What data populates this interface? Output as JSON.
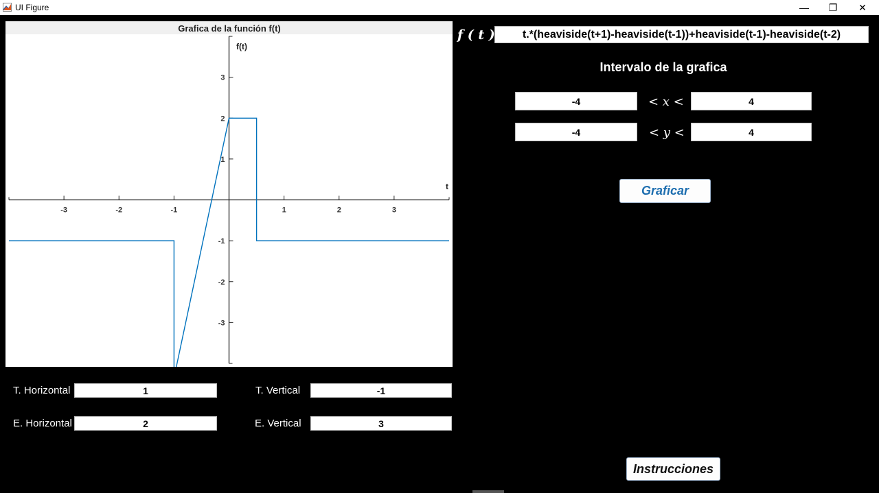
{
  "window": {
    "title": "UI Figure",
    "controls": {
      "minimize": "—",
      "restore": "❐",
      "close": "✕"
    }
  },
  "plot": {
    "title": "Grafica de la función f(t)",
    "xlabel": "t",
    "ylabel": "f(t)",
    "line_color": "#0072BD"
  },
  "chart_data": {
    "type": "line",
    "title": "Grafica de la función f(t)",
    "xlabel": "t",
    "ylabel": "f(t)",
    "xlim": [
      -4,
      4
    ],
    "ylim": [
      -4,
      4
    ],
    "x_ticks": [
      -3,
      -2,
      -1,
      1,
      2,
      3
    ],
    "y_ticks": [
      -3,
      -2,
      -1,
      1,
      2,
      3
    ],
    "grid": false,
    "axis_location": "origin",
    "series": [
      {
        "x": [
          -4,
          -1,
          -1,
          0,
          0,
          0.5,
          0.5,
          4
        ],
        "y": [
          -1,
          -1,
          -4.35,
          2,
          2,
          2,
          -1,
          -1
        ]
      }
    ]
  },
  "function_input": {
    "label": "f ( t ) :",
    "value": "t.*(heaviside(t+1)-heaviside(t-1))+heaviside(t-1)-heaviside(t-2)"
  },
  "interval": {
    "heading": "Intervalo de la grafica",
    "x_min": "-4",
    "x_max": "4",
    "x_symbol": "< x <",
    "y_min": "-4",
    "y_max": "4",
    "y_symbol": "< y <"
  },
  "graph_button": {
    "label": "Graficar",
    "color": "#1f6fb0"
  },
  "instructions_button": {
    "label": "Instrucciones",
    "color": "#111111"
  },
  "transform": {
    "t_horizontal_label": "T. Horizontal",
    "t_horizontal_value": "1",
    "t_vertical_label": "T. Vertical",
    "t_vertical_value": "-1",
    "e_horizontal_label": "E. Horizontal",
    "e_horizontal_value": "2",
    "e_vertical_label": "E. Vertical",
    "e_vertical_value": "3"
  }
}
